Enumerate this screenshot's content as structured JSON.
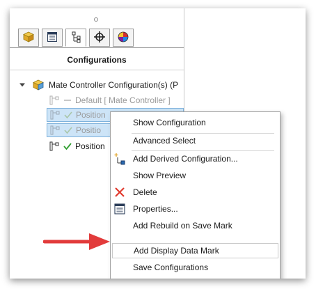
{
  "panel": {
    "title": "Configurations",
    "tabs": [
      {
        "icon": "part-cube-icon"
      },
      {
        "icon": "property-manager-icon"
      },
      {
        "icon": "configuration-manager-icon"
      },
      {
        "icon": "dimxpert-crosshair-icon"
      },
      {
        "icon": "display-manager-pie-icon"
      }
    ],
    "active_tab": 2
  },
  "tree": {
    "root_label": "Mate Controller Configuration(s)  (P",
    "rows": [
      {
        "label": "Default [ Mate Controller ]",
        "state": "dim",
        "mark": "dash"
      },
      {
        "label": "Position",
        "state": "selected-dim",
        "mark": "check"
      },
      {
        "label": "Positio",
        "state": "selected-dim",
        "mark": "check"
      },
      {
        "label": "Position",
        "state": "normal",
        "mark": "check"
      }
    ]
  },
  "context_menu": {
    "items": [
      {
        "label": "Show Configuration",
        "icon": ""
      },
      {
        "label": "Advanced Select",
        "icon": ""
      },
      {
        "label": "Add Derived Configuration...",
        "icon": "derived-config-icon"
      },
      {
        "label": "Show Preview",
        "icon": ""
      },
      {
        "label": "Delete",
        "icon": "delete-x-icon"
      },
      {
        "label": "Properties...",
        "icon": "properties-icon"
      },
      {
        "label": "Add Rebuild on Save Mark",
        "icon": ""
      },
      {
        "label": "Add Display Data Mark",
        "icon": "",
        "highlighted": true
      },
      {
        "label": "Save Configurations",
        "icon": ""
      }
    ]
  },
  "colors": {
    "selection": "#cde4f7",
    "check": "#2e9e2e",
    "delete": "#e03a2e",
    "arrow": "#e23b3b"
  }
}
